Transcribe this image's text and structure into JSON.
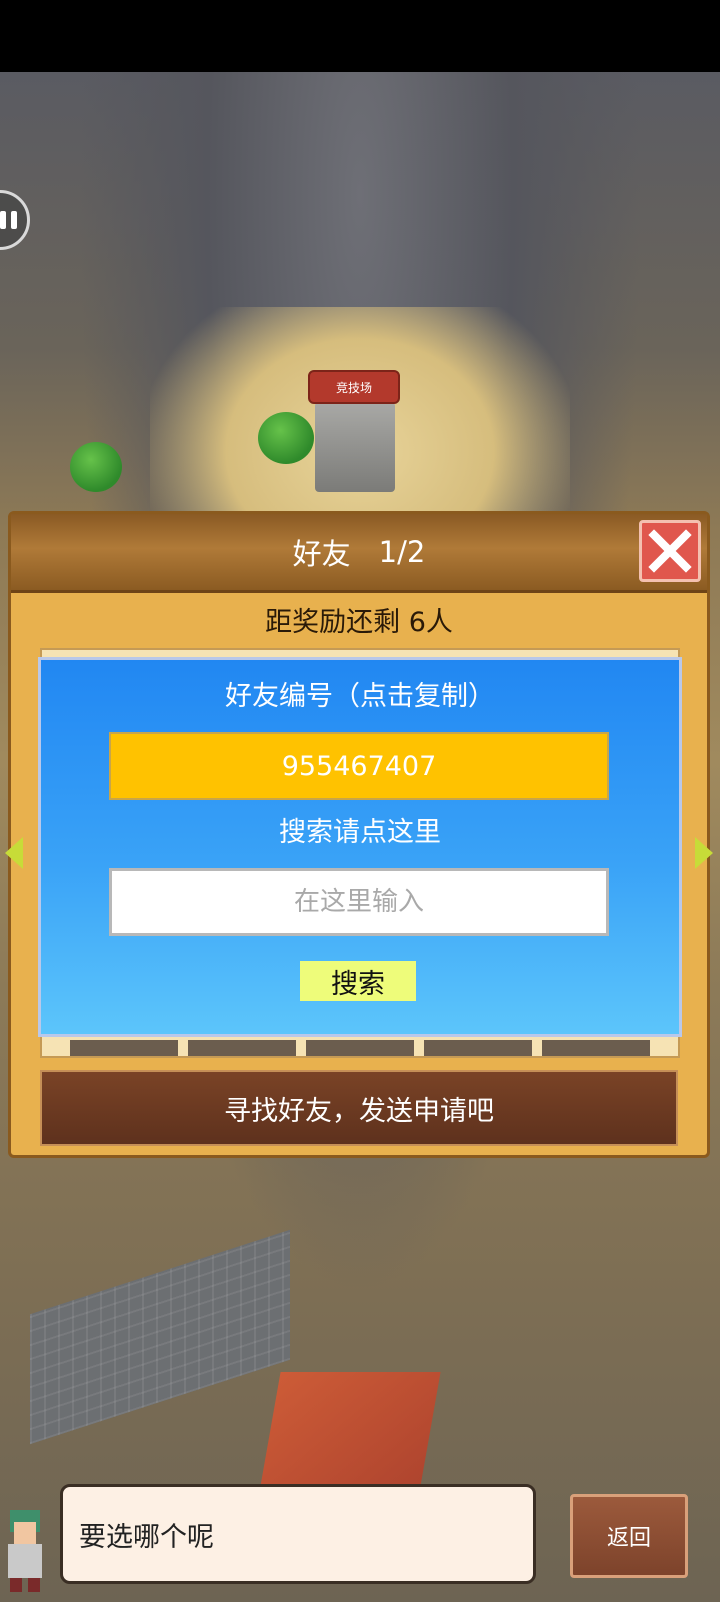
{
  "map": {
    "arena_sign": "竞技场"
  },
  "friends_panel": {
    "title": "好友",
    "page": "1/2",
    "reward_remaining": "距奖励还剩 6人",
    "find_prompt": "寻找好友，发送申请吧"
  },
  "friend_dialog": {
    "id_label": "好友编号（点击复制）",
    "friend_id": "955467407",
    "search_label": "搜索请点这里",
    "search_placeholder": "在这里输入",
    "search_button": "搜索"
  },
  "bottom": {
    "speech": "要选哪个呢",
    "back_button": "返回"
  },
  "colors": {
    "dialog_blue": "#2187f2",
    "id_box": "#ffc200",
    "search_button": "#eefc7a",
    "close_red": "#e0574d",
    "panel_gold": "#e8b14e"
  },
  "icons": [
    "pause-icon",
    "close-icon",
    "arrow-left-icon",
    "arrow-right-icon"
  ]
}
